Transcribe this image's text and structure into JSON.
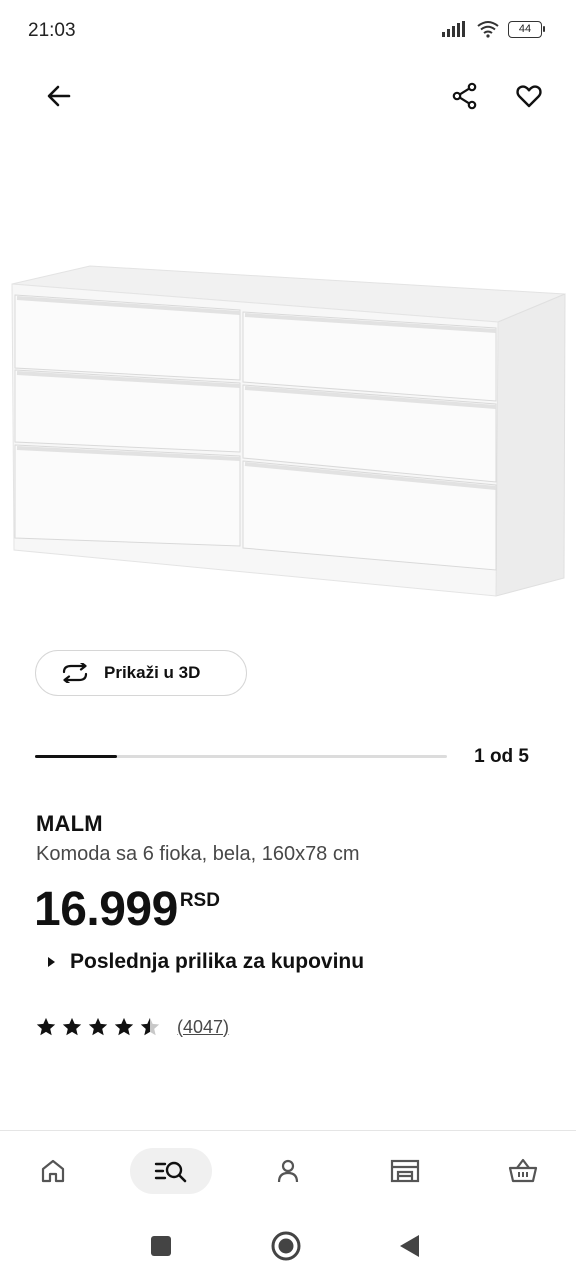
{
  "status_bar": {
    "time": "21:03",
    "battery": "44",
    "icons": [
      "signal-icon",
      "wifi-icon",
      "battery-icon"
    ]
  },
  "top_bar": {
    "icons": [
      "back-arrow-icon",
      "share-icon",
      "heart-icon"
    ]
  },
  "gallery": {
    "view_3d_label": "Prikaži u 3D",
    "view_3d_icon": "rotate-3d-icon",
    "page_indicator": "1 od 5",
    "progress": 0.2
  },
  "product": {
    "name": "MALM",
    "description": "Komoda sa 6 fioka, bela, 160x78 cm",
    "price": "16.999",
    "currency": "RSD",
    "availability_label": "Poslednja prilika za kupovinu",
    "rating": 4.5,
    "rating_max": 5,
    "review_count": "(4047)"
  },
  "bottom_nav": {
    "items": [
      "home-icon",
      "search-list-icon",
      "profile-icon",
      "store-icon",
      "basket-icon"
    ],
    "active": "search-list-icon"
  },
  "system_nav": {
    "items": [
      "recents-icon",
      "home-circle-icon",
      "back-triangle-icon"
    ]
  },
  "colors": {
    "text_primary": "#111111",
    "text_secondary": "#484848",
    "border": "#d6d6d6",
    "active_nav_bg": "#f0f0f0"
  }
}
